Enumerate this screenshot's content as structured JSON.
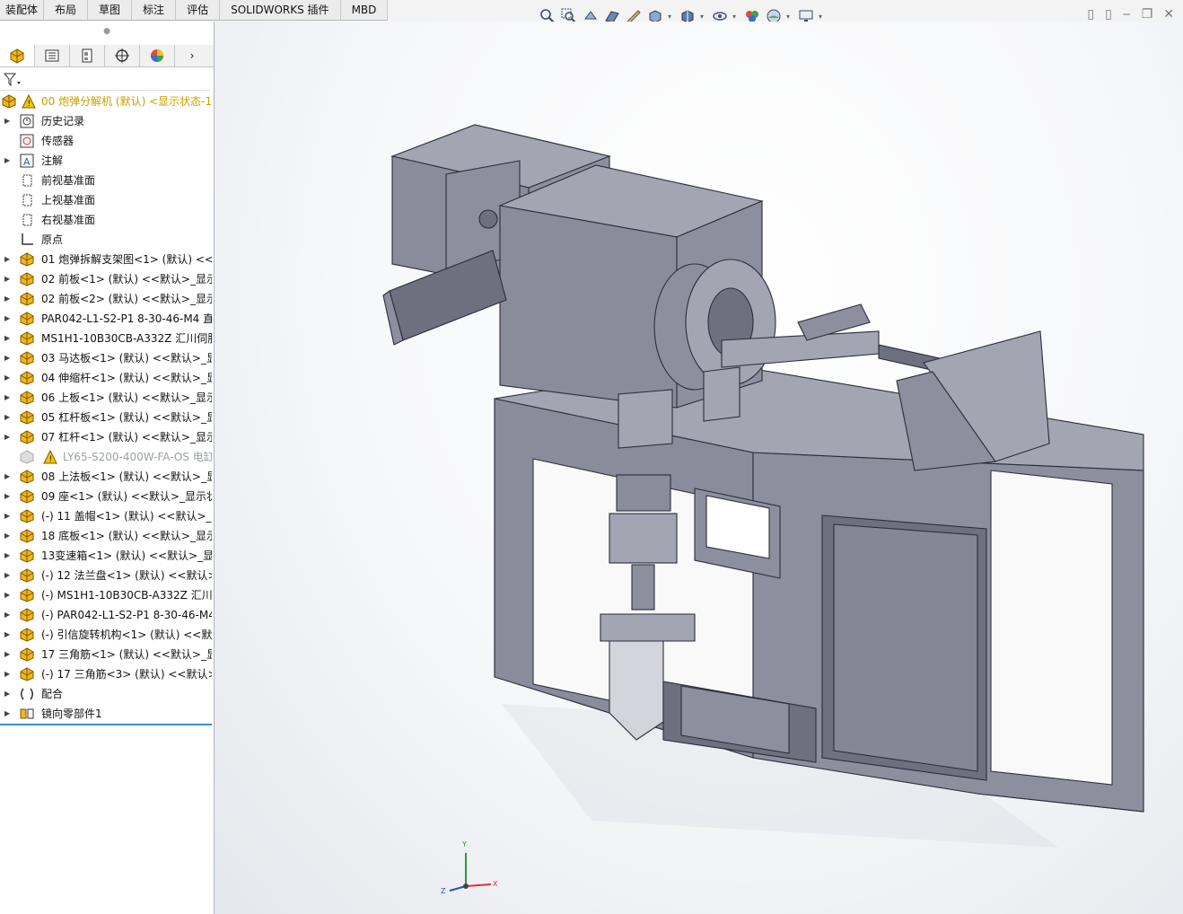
{
  "tabs": [
    "装配体",
    "布局",
    "草图",
    "标注",
    "评估",
    "SOLIDWORKS 插件",
    "MBD"
  ],
  "hud_icons": [
    "zoom-to-fit-icon",
    "zoom-area-icon",
    "previous-view-icon",
    "section-view-icon",
    "dynamic-annotation-icon",
    "view-orientation-icon",
    "display-style-icon",
    "hide-show-icon",
    "edit-appearance-icon",
    "apply-scene-icon",
    "view-settings-icon"
  ],
  "panel_tabs": [
    "featuremanager-icon",
    "propertymanager-icon",
    "configurationmanager-icon",
    "dimxpert-icon",
    "displaymanager-icon"
  ],
  "tree": {
    "root": "00 炮弹分解机 (默认) <显示状态-1",
    "items": [
      {
        "label": "历史记录",
        "icon": "history-icon",
        "expand": true
      },
      {
        "label": "传感器",
        "icon": "sensor-icon",
        "expand": false
      },
      {
        "label": "注解",
        "icon": "annotation-icon",
        "expand": true
      },
      {
        "label": "前视基准面",
        "icon": "plane-icon",
        "expand": false
      },
      {
        "label": "上视基准面",
        "icon": "plane-icon",
        "expand": false
      },
      {
        "label": "右视基准面",
        "icon": "plane-icon",
        "expand": false
      },
      {
        "label": "原点",
        "icon": "origin-icon",
        "expand": false
      },
      {
        "label": "01 炮弹拆解支架图<1> (默认) <<默",
        "icon": "part-icon",
        "expand": true
      },
      {
        "label": "02 前板<1> (默认) <<默认>_显示",
        "icon": "part-icon",
        "expand": true
      },
      {
        "label": "02 前板<2> (默认) <<默认>_显示",
        "icon": "part-icon",
        "expand": true
      },
      {
        "label": "PAR042-L1-S2-P1 8-30-46-M4 直",
        "icon": "part-icon",
        "expand": true
      },
      {
        "label": "MS1H1-10B30CB-A332Z 汇川伺服",
        "icon": "part-icon",
        "expand": true
      },
      {
        "label": "03 马达板<1> (默认) <<默认>_显示",
        "icon": "part-icon",
        "expand": true
      },
      {
        "label": "04 伸缩杆<1> (默认) <<默认>_显示",
        "icon": "part-icon",
        "expand": true
      },
      {
        "label": "06 上板<1> (默认) <<默认>_显示",
        "icon": "part-icon",
        "expand": true
      },
      {
        "label": "05 杠杆板<1> (默认) <<默认>_显示",
        "icon": "part-icon",
        "expand": true
      },
      {
        "label": "07 杠杆<1> (默认) <<默认>_显示",
        "icon": "part-icon",
        "expand": true
      },
      {
        "label": "LY65-S200-400W-FA-OS 电缸",
        "icon": "part-suppressed-icon",
        "expand": false,
        "suppressed": true
      },
      {
        "label": "08 上法板<1> (默认) <<默认>_显示",
        "icon": "part-icon",
        "expand": true
      },
      {
        "label": "09 座<1> (默认) <<默认>_显示状态",
        "icon": "part-icon",
        "expand": true
      },
      {
        "label": "(-) 11 盖帽<1> (默认) <<默认>_显示",
        "icon": "part-icon",
        "expand": true
      },
      {
        "label": "18 底板<1> (默认) <<默认>_显示",
        "icon": "part-icon",
        "expand": true
      },
      {
        "label": "13变速箱<1> (默认) <<默认>_显示",
        "icon": "part-icon",
        "expand": true
      },
      {
        "label": "(-) 12 法兰盘<1> (默认) <<默认>_",
        "icon": "part-icon",
        "expand": true
      },
      {
        "label": "(-) MS1H1-10B30CB-A332Z 汇川伺",
        "icon": "part-icon",
        "expand": true
      },
      {
        "label": "(-) PAR042-L1-S2-P1 8-30-46-M4",
        "icon": "part-icon",
        "expand": true
      },
      {
        "label": "(-) 引信旋转机构<1> (默认) <<默认",
        "icon": "part-icon",
        "expand": true
      },
      {
        "label": "17 三角筋<1> (默认) <<默认>_显示",
        "icon": "part-icon",
        "expand": true
      },
      {
        "label": "(-) 17 三角筋<3> (默认) <<默认>_",
        "icon": "part-icon",
        "expand": true
      },
      {
        "label": "配合",
        "icon": "mates-icon",
        "expand": true
      },
      {
        "label": "镜向零部件1",
        "icon": "mirror-component-icon",
        "expand": true
      }
    ]
  },
  "triad": {
    "x": "X",
    "y": "Y",
    "z": "Z"
  },
  "colors": {
    "model_face": "#8d8f9e",
    "model_dark": "#6e7080",
    "model_light": "#a3a5b3",
    "root_warn": "#c8a000",
    "part_icon": "#f2b51c"
  }
}
